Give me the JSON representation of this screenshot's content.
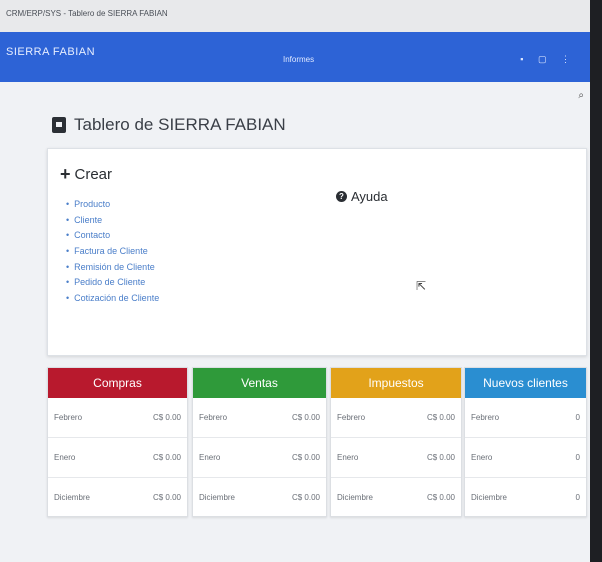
{
  "window": {
    "tab_title": "CRM/ERP/SYS - Tablero de SIERRA FABIAN"
  },
  "topnav": {
    "brand": "SIERRA FABIAN",
    "informes": "Informes",
    "icons": "▪ ▢ ⋮"
  },
  "page": {
    "title": "Tablero de SIERRA FABIAN"
  },
  "crear": {
    "title": "Crear",
    "items": [
      "Producto",
      "Cliente",
      "Contacto",
      "Factura de Cliente",
      "Remisión de Cliente",
      "Pedido de Cliente",
      "Cotización de Cliente"
    ]
  },
  "ayuda": {
    "label": "Ayuda"
  },
  "cards": [
    {
      "title": "Compras",
      "color": "#b8192d",
      "rows": [
        {
          "label": "Febrero",
          "value": "C$ 0.00"
        },
        {
          "label": "Enero",
          "value": "C$ 0.00"
        },
        {
          "label": "Diciembre",
          "value": "C$ 0.00"
        }
      ]
    },
    {
      "title": "Ventas",
      "color": "#2f9a3a",
      "rows": [
        {
          "label": "Febrero",
          "value": "C$ 0.00"
        },
        {
          "label": "Enero",
          "value": "C$ 0.00"
        },
        {
          "label": "Diciembre",
          "value": "C$ 0.00"
        }
      ]
    },
    {
      "title": "Impuestos",
      "color": "#e2a21a",
      "rows": [
        {
          "label": "Febrero",
          "value": "C$ 0.00"
        },
        {
          "label": "Enero",
          "value": "C$ 0.00"
        },
        {
          "label": "Diciembre",
          "value": "C$ 0.00"
        }
      ]
    },
    {
      "title": "Nuevos clientes",
      "color": "#2a8ed1",
      "rows": [
        {
          "label": "Febrero",
          "value": "0"
        },
        {
          "label": "Enero",
          "value": "0"
        },
        {
          "label": "Diciembre",
          "value": "0"
        }
      ]
    }
  ]
}
